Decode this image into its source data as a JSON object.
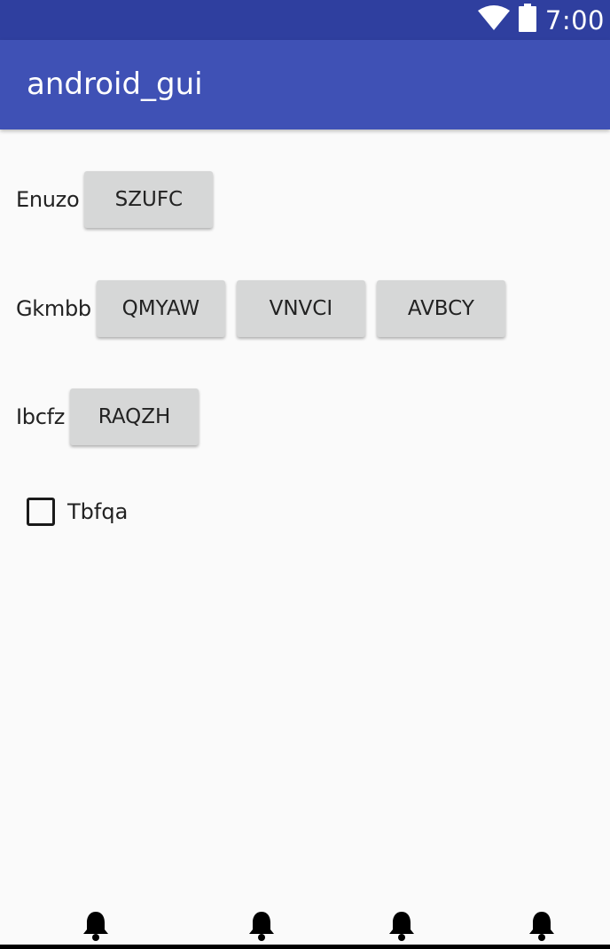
{
  "status_bar": {
    "time": "7:00",
    "icons": [
      "wifi-icon",
      "battery-icon"
    ],
    "background": "#2f3f9f"
  },
  "app_bar": {
    "title": "android_gui",
    "background": "#3f51b5"
  },
  "rows": [
    {
      "label": "Enuzo",
      "buttons": [
        "SZUFC"
      ]
    },
    {
      "label": "Gkmbb",
      "buttons": [
        "QMYAW",
        "VNVCI",
        "AVBCY"
      ]
    },
    {
      "label": "Ibcfz",
      "buttons": [
        "RAQZH"
      ]
    }
  ],
  "checkbox": {
    "label": "Tbfqa",
    "checked": false
  },
  "bottom_icons": [
    "bell-icon",
    "bell-icon",
    "bell-icon",
    "bell-icon"
  ]
}
